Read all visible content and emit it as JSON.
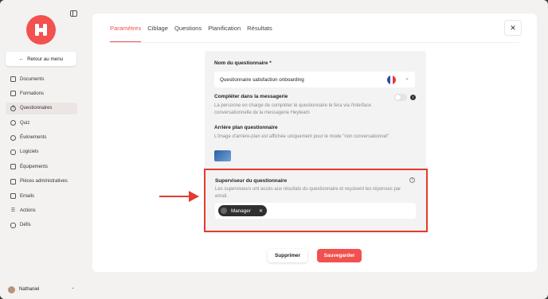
{
  "sidebar": {
    "back_label": "Retour au menu",
    "items": [
      {
        "label": "Documents",
        "icon": "document-icon"
      },
      {
        "label": "Formations",
        "icon": "book-icon"
      },
      {
        "label": "Questionnaires",
        "icon": "question-icon"
      },
      {
        "label": "Quiz",
        "icon": "quiz-icon"
      },
      {
        "label": "Événements",
        "icon": "people-icon"
      },
      {
        "label": "Logiciels",
        "icon": "mouse-icon"
      },
      {
        "label": "Équipements",
        "icon": "monitor-icon"
      },
      {
        "label": "Pièces administratives",
        "icon": "files-icon"
      },
      {
        "label": "Emails",
        "icon": "mail-icon"
      },
      {
        "label": "Actions",
        "icon": "list-icon"
      },
      {
        "label": "Défis",
        "icon": "gamepad-icon"
      }
    ],
    "active_index": 2,
    "user_name": "Nathaniel"
  },
  "tabs": [
    "Paramètres",
    "Ciblage",
    "Questions",
    "Planification",
    "Résultats"
  ],
  "active_tab": 0,
  "form": {
    "name_label": "Nom du questionnaire *",
    "name_value": "Questionnaire satisfaction onboarding",
    "messaging_label": "Compléter dans la messagerie",
    "messaging_help": "La personne en charge de compléter le questionnaire le fera via l'interface conversationnelle de la messagerie Heyteam",
    "bg_label": "Arrière plan questionnaire",
    "bg_help": "L'image d'arrière-plan est affichée uniquement pour le mode \"non conversationnel\"",
    "supervisor_label": "Superviseur du questionnaire",
    "supervisor_help": "Les superviseurs ont accès aux résultats du questionnaire et reçoivent les réponses par email.",
    "supervisor_chip": "Manager"
  },
  "actions": {
    "delete_label": "Supprimer",
    "save_label": "Sauvegarder"
  },
  "colors": {
    "accent": "#f2514f",
    "highlight": "#e33b2e"
  }
}
